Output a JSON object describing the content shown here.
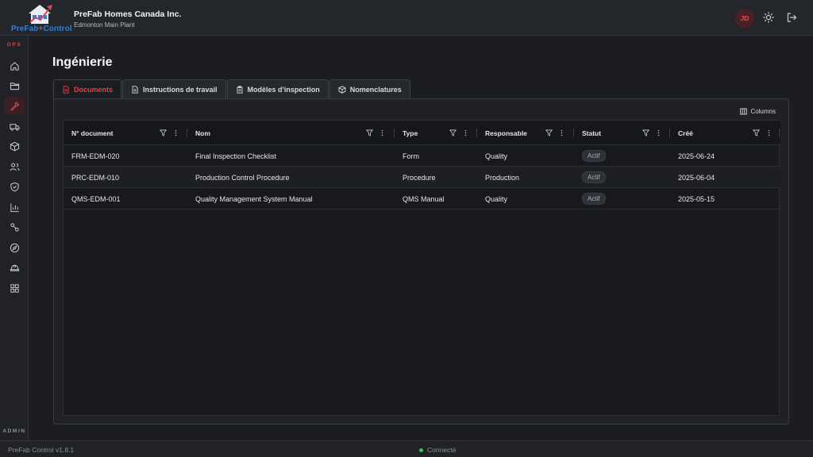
{
  "header": {
    "logo_text_a": "PreFab",
    "logo_text_plus": "+",
    "logo_text_b": "Control",
    "company_name": "PreFab Homes Canada Inc.",
    "site_name": "Edmonton Main Plant",
    "user_initials": "JD"
  },
  "sidebar": {
    "section_ops": "OPS",
    "section_admin": "ADMIN",
    "items": [
      {
        "icon": "home-icon"
      },
      {
        "icon": "folder-icon"
      },
      {
        "icon": "wrench-icon",
        "active": true
      },
      {
        "icon": "truck-icon"
      },
      {
        "icon": "box-icon"
      },
      {
        "icon": "users-icon"
      },
      {
        "icon": "shield-icon"
      },
      {
        "icon": "chart-icon"
      },
      {
        "icon": "workflow-icon"
      },
      {
        "icon": "compass-icon"
      },
      {
        "icon": "hardhat-icon"
      },
      {
        "icon": "grid-icon"
      }
    ]
  },
  "page": {
    "title": "Ingénierie",
    "tabs": [
      "Documents",
      "Instructions de travail",
      "Modèles d'inspection",
      "Nomenclatures"
    ],
    "columns_label": "Columns"
  },
  "table": {
    "headers": [
      "N° document",
      "Nom",
      "Type",
      "Responsable",
      "Statut",
      "Créé"
    ],
    "rows": [
      {
        "number": "FRM-EDM-020",
        "name": "Final Inspection Checklist",
        "type": "Form",
        "owner": "Quality",
        "status": "Actif",
        "created": "2025-06-24"
      },
      {
        "number": "PRC-EDM-010",
        "name": "Production Control Procedure",
        "type": "Procedure",
        "owner": "Production",
        "status": "Actif",
        "created": "2025-06-04"
      },
      {
        "number": "QMS-EDM-001",
        "name": "Quality Management System Manual",
        "type": "QMS Manual",
        "owner": "Quality",
        "status": "Actif",
        "created": "2025-05-15"
      }
    ]
  },
  "footer": {
    "version": "PreFab Control v1.8.1",
    "connection": "Connecté"
  },
  "colors": {
    "accent": "#e2414c",
    "brand_blue": "#2f7fd9",
    "connected": "#3fc060"
  }
}
